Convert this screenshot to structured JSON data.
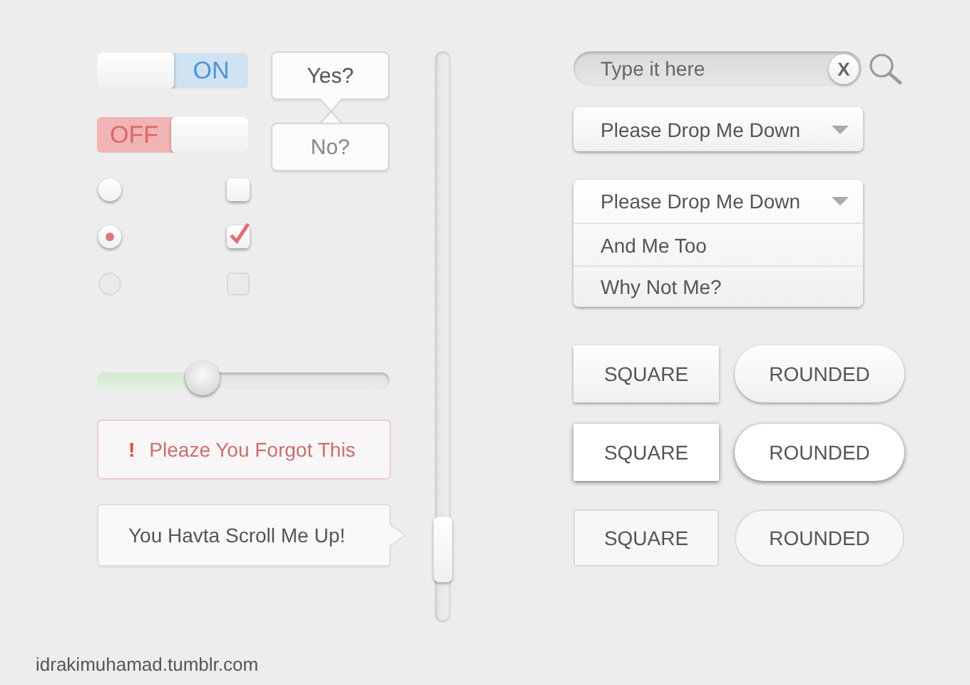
{
  "toggles": [
    {
      "label": "ON",
      "on": true
    },
    {
      "label": "OFF",
      "on": false
    }
  ],
  "bubbles": [
    {
      "text": "Yes?",
      "kind": "below",
      "muted": false
    },
    {
      "text": "No?",
      "kind": "above",
      "muted": true
    }
  ],
  "radios": [
    {
      "checked": false,
      "disabled": false
    },
    {
      "checked": true,
      "disabled": false
    },
    {
      "checked": false,
      "disabled": true
    }
  ],
  "checkboxes": [
    {
      "checked": false,
      "disabled": false
    },
    {
      "checked": true,
      "disabled": false
    },
    {
      "checked": false,
      "disabled": true
    }
  ],
  "slider": {
    "level": 0.36
  },
  "error_field": {
    "icon": "!",
    "message": "Pleaze You Forgot This"
  },
  "scroll_bubble": {
    "text": "You Havta Scroll Me Up!"
  },
  "search": {
    "placeholder": "Type it here",
    "clear": "X"
  },
  "dropdowns": [
    {
      "label": "Please Drop Me Down",
      "expanded": false
    },
    {
      "label": "Please Drop Me Down",
      "expanded": true,
      "options": [
        "And Me Too",
        "Why Not Me?"
      ]
    }
  ],
  "button_rows": [
    [
      {
        "label": "SQUARE",
        "kind": "square",
        "highlighted": false,
        "disabled": false
      },
      {
        "label": "ROUNDED",
        "kind": "rounded",
        "highlighted": false,
        "disabled": false
      }
    ],
    [
      {
        "label": "SQUARE",
        "kind": "square",
        "highlighted": true,
        "disabled": false
      },
      {
        "label": "ROUNDED",
        "kind": "rounded",
        "highlighted": true,
        "disabled": false
      }
    ],
    [
      {
        "label": "SQUARE",
        "kind": "square",
        "highlighted": false,
        "disabled": true
      },
      {
        "label": "ROUNDED",
        "kind": "rounded",
        "highlighted": false,
        "disabled": true
      }
    ]
  ],
  "credit": "idrakimuhamad.tumblr.com"
}
